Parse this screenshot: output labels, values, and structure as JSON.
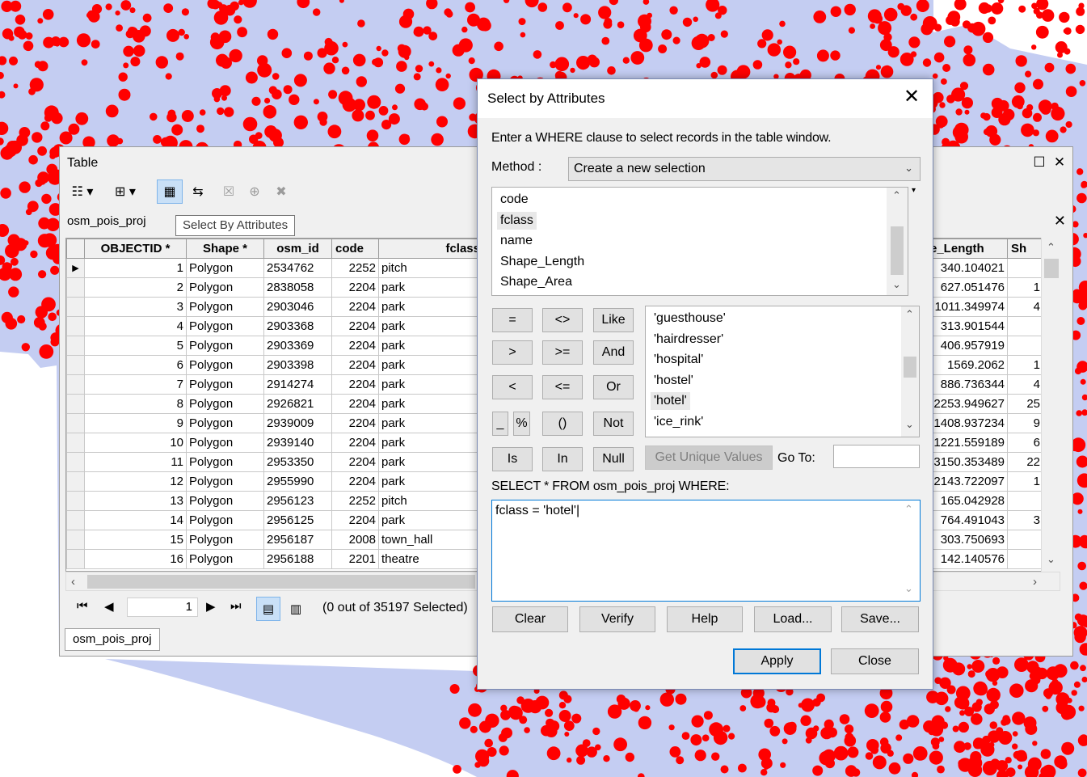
{
  "table_window": {
    "title": "Table",
    "tab_name": "osm_pois_proj",
    "tooltip": "Select By Attributes",
    "columns": [
      "OBJECTID *",
      "Shape *",
      "osm_id",
      "code",
      "fclass"
    ],
    "right_columns": [
      "e_Length",
      "Sh"
    ],
    "rows": [
      [
        "1",
        "Polygon",
        "2534762",
        "2252",
        "pitch",
        "340.104021"
      ],
      [
        "2",
        "Polygon",
        "2838058",
        "2204",
        "park",
        "627.051476"
      ],
      [
        "3",
        "Polygon",
        "2903046",
        "2204",
        "park",
        "1011.349974"
      ],
      [
        "4",
        "Polygon",
        "2903368",
        "2204",
        "park",
        "313.901544"
      ],
      [
        "5",
        "Polygon",
        "2903369",
        "2204",
        "park",
        "406.957919"
      ],
      [
        "6",
        "Polygon",
        "2903398",
        "2204",
        "park",
        "1569.2062"
      ],
      [
        "7",
        "Polygon",
        "2914274",
        "2204",
        "park",
        "886.736344"
      ],
      [
        "8",
        "Polygon",
        "2926821",
        "2204",
        "park",
        "2253.949627"
      ],
      [
        "9",
        "Polygon",
        "2939009",
        "2204",
        "park",
        "1408.937234"
      ],
      [
        "10",
        "Polygon",
        "2939140",
        "2204",
        "park",
        "1221.559189"
      ],
      [
        "11",
        "Polygon",
        "2953350",
        "2204",
        "park",
        "3150.353489"
      ],
      [
        "12",
        "Polygon",
        "2955990",
        "2204",
        "park",
        "2143.722097"
      ],
      [
        "13",
        "Polygon",
        "2956123",
        "2252",
        "pitch",
        "165.042928"
      ],
      [
        "14",
        "Polygon",
        "2956125",
        "2204",
        "park",
        "764.491043"
      ],
      [
        "15",
        "Polygon",
        "2956187",
        "2008",
        "town_hall",
        "303.750693"
      ],
      [
        "16",
        "Polygon",
        "2956188",
        "2201",
        "theatre",
        "142.140576"
      ]
    ],
    "right_partial": [
      "",
      "1",
      "4",
      "",
      "",
      "1",
      "4",
      "25",
      "9",
      "6",
      "22",
      "1",
      "",
      "3",
      "",
      ""
    ],
    "current_record": "1",
    "selection_info": "(0 out of 35197 Selected)",
    "bottom_tab": "osm_pois_proj"
  },
  "dialog": {
    "title": "Select by Attributes",
    "instruction": "Enter a WHERE clause to select records in the table window.",
    "method_label": "Method :",
    "method_value": "Create a new selection",
    "fields": [
      "code",
      "fclass",
      "name",
      "Shape_Length",
      "Shape_Area"
    ],
    "selected_field": "fclass",
    "operators": [
      [
        "=",
        "<>",
        "Like"
      ],
      [
        ">",
        ">=",
        "And"
      ],
      [
        "<",
        "<=",
        "Or"
      ],
      [
        "_",
        "%",
        "()",
        "Not"
      ],
      [
        "Is",
        "In",
        "Null"
      ]
    ],
    "values": [
      "'guesthouse'",
      "'hairdresser'",
      "'hospital'",
      "'hostel'",
      "'hotel'",
      "'ice_rink'"
    ],
    "selected_value": "'hotel'",
    "get_unique_values": "Get Unique Values",
    "goto_label": "Go To:",
    "goto_value": "",
    "sql_prefix": "SELECT * FROM osm_pois_proj WHERE:",
    "expression": "fclass = 'hotel'",
    "buttons": {
      "clear": "Clear",
      "verify": "Verify",
      "help": "Help",
      "load": "Load...",
      "save": "Save...",
      "apply": "Apply",
      "close": "Close"
    }
  },
  "colors": {
    "map_water": "#c4cdf2",
    "map_points": "#ff0000",
    "focus": "#0078d7",
    "selected_button": "#c9e0f7"
  }
}
